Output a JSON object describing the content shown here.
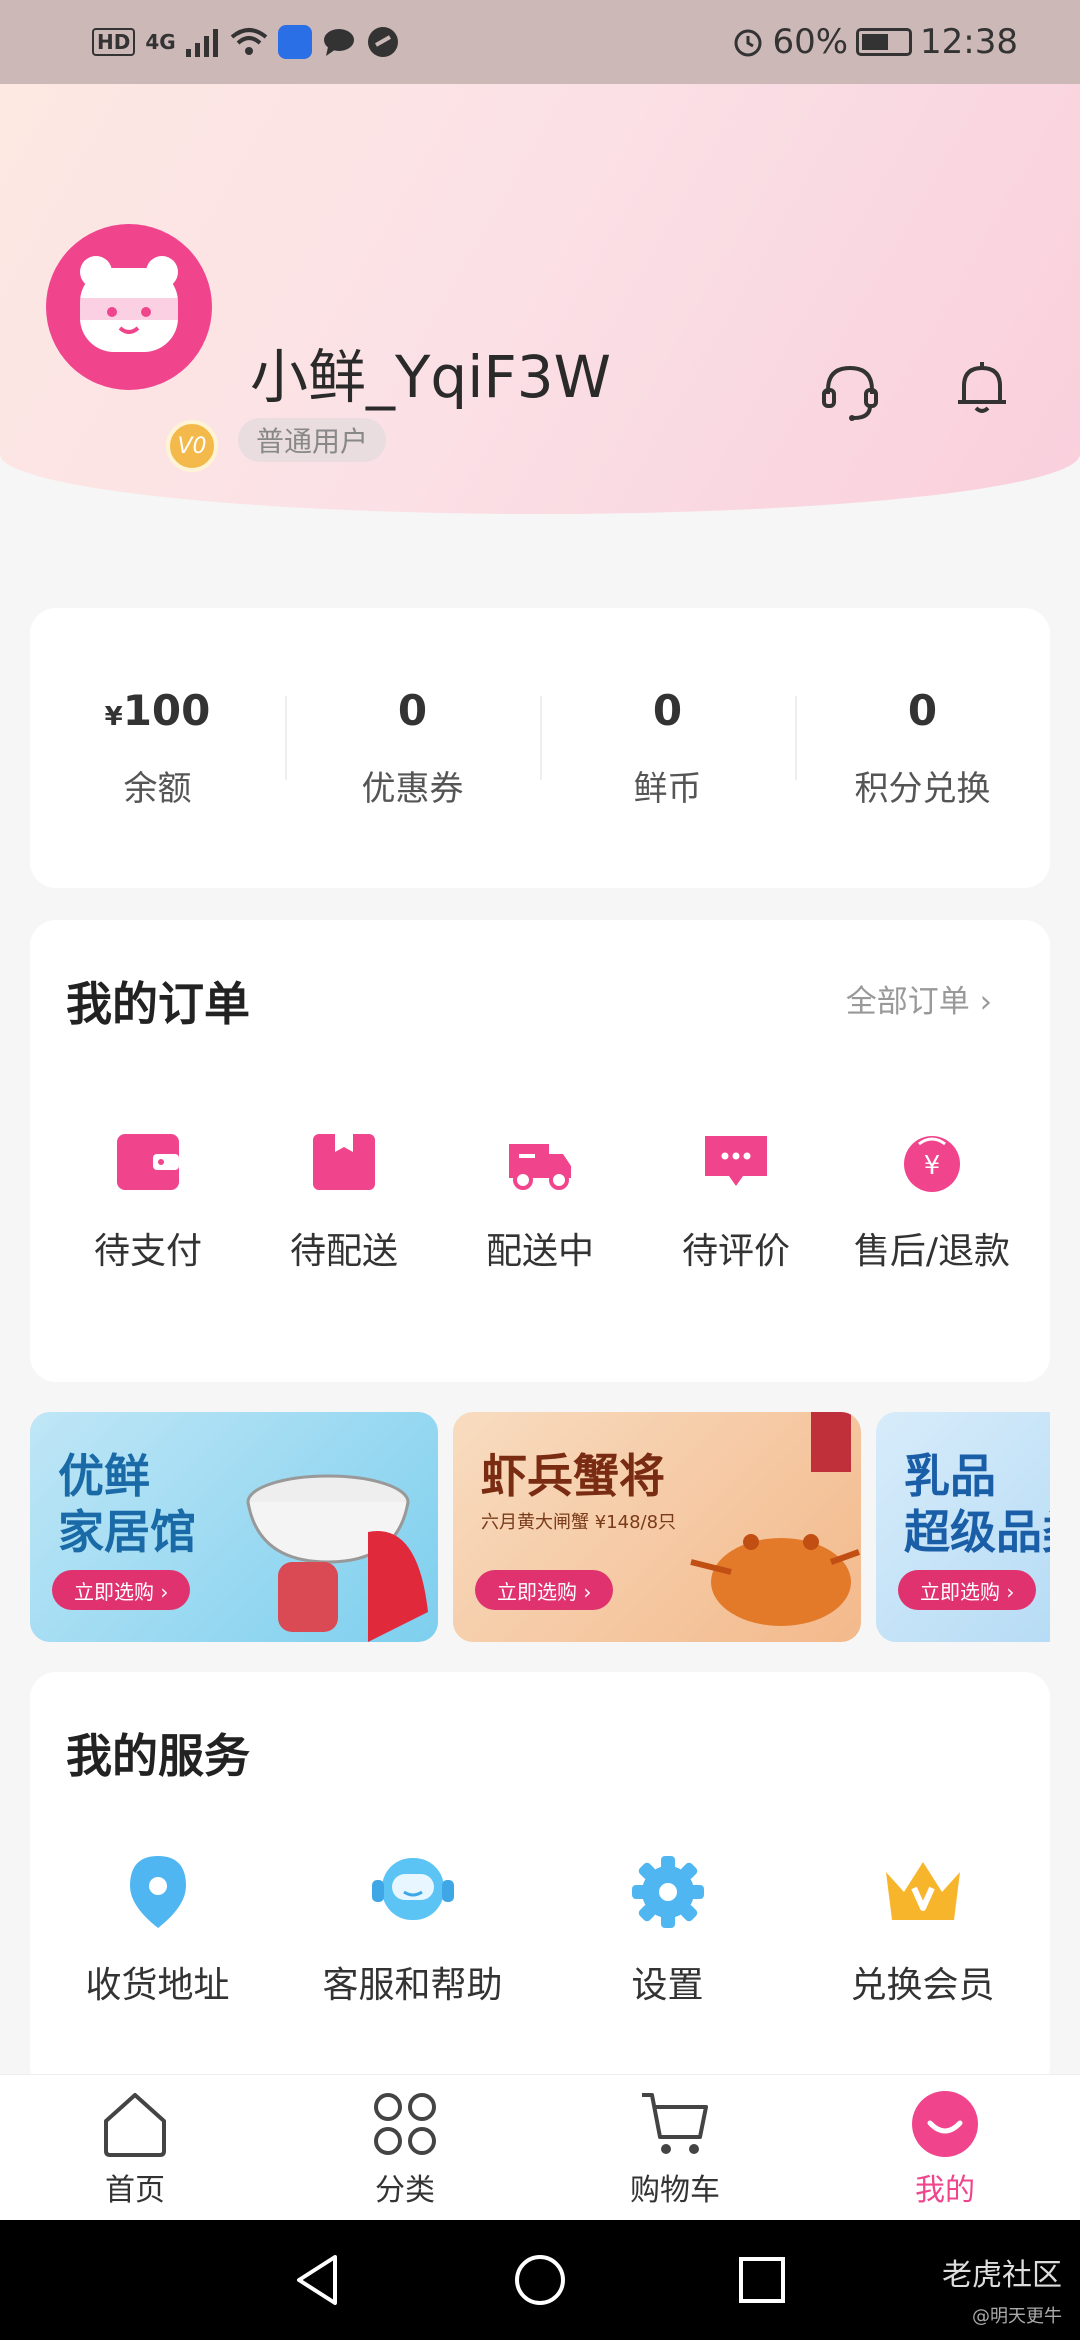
{
  "status_bar": {
    "network": "4G",
    "battery": "60%",
    "battery_level": 0.6,
    "time": "12:38"
  },
  "profile": {
    "username": "小鲜_YqiF3W",
    "level_label": "普通用户",
    "vip_badge": "V0"
  },
  "stats": [
    {
      "value": "100",
      "prefix": "¥",
      "label": "余额"
    },
    {
      "value": "0",
      "prefix": "",
      "label": "优惠券"
    },
    {
      "value": "0",
      "prefix": "",
      "label": "鲜币"
    },
    {
      "value": "0",
      "prefix": "",
      "label": "积分兑换"
    }
  ],
  "orders": {
    "title": "我的订单",
    "all_label": "全部订单 ›",
    "items": [
      {
        "label": "待支付",
        "icon": "wallet-icon"
      },
      {
        "label": "待配送",
        "icon": "box-icon"
      },
      {
        "label": "配送中",
        "icon": "truck-icon"
      },
      {
        "label": "待评价",
        "icon": "comment-icon"
      },
      {
        "label": "售后/退款",
        "icon": "refund-icon"
      }
    ]
  },
  "banners": [
    {
      "title_line1": "优鲜",
      "title_line2": "家居馆",
      "sub": "",
      "button": "立即选购 ›"
    },
    {
      "title_line1": "虾兵蟹将",
      "title_line2": "",
      "sub": "六月黄大闸蟹 ¥148/8只",
      "button": "立即选购 ›"
    },
    {
      "title_line1": "乳品",
      "title_line2": "超级品类",
      "sub": "",
      "button": "立即选购 ›"
    }
  ],
  "services": {
    "title": "我的服务",
    "items": [
      {
        "label": "收货地址",
        "icon": "location-pin-icon"
      },
      {
        "label": "客服和帮助",
        "icon": "headset-icon"
      },
      {
        "label": "设置",
        "icon": "gear-icon"
      },
      {
        "label": "兑换会员",
        "icon": "crown-icon"
      }
    ]
  },
  "tabbar": [
    {
      "label": "首页",
      "icon": "home-icon",
      "active": false
    },
    {
      "label": "分类",
      "icon": "grid-icon",
      "active": false
    },
    {
      "label": "购物车",
      "icon": "cart-icon",
      "active": false
    },
    {
      "label": "我的",
      "icon": "smile-icon",
      "active": true
    }
  ],
  "watermark": {
    "line1": "老虎社区",
    "line2": "@明天更牛"
  },
  "colors": {
    "accent": "#f0458d",
    "accent_dark": "#e0326f"
  }
}
